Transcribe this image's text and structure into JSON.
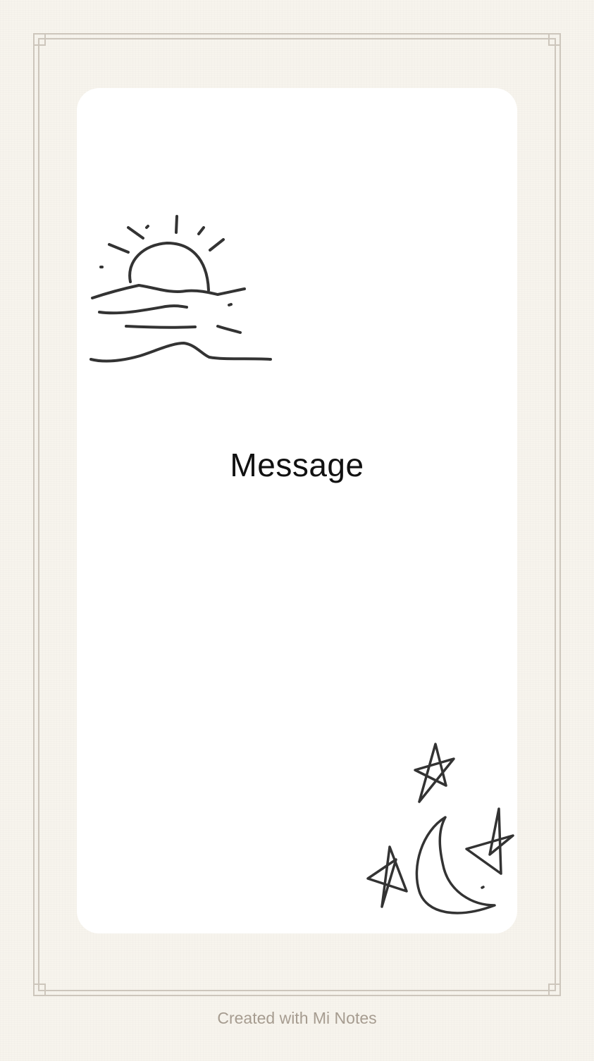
{
  "note": {
    "message": "Message",
    "footer": "Created with Mi Notes"
  },
  "theme": {
    "background": "#f7f4ed",
    "card": "#ffffff",
    "frame": "#cdc6bc",
    "ink": "#333333",
    "footer_text": "#a69c90"
  },
  "doodles": {
    "top_left": "sunset-over-water-icon",
    "bottom_right": "crescent-moon-and-stars-icon"
  }
}
